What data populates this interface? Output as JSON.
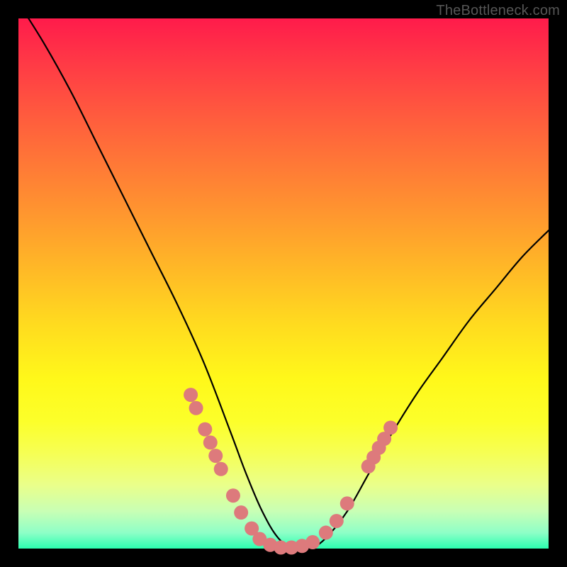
{
  "watermark": "TheBottleneck.com",
  "colors": {
    "frame_border": "#000000",
    "gradient_top": "#ff1b4b",
    "gradient_bottom": "#2bffb0",
    "curve": "#000000",
    "markers": "#dd7a7c"
  },
  "chart_data": {
    "type": "line",
    "title": "",
    "xlabel": "",
    "ylabel": "",
    "xlim": [
      0,
      100
    ],
    "ylim": [
      0,
      100
    ],
    "series": [
      {
        "name": "bottleneck-curve",
        "x": [
          0,
          5,
          10,
          15,
          20,
          25,
          30,
          35,
          40,
          43,
          46,
          49,
          52,
          55,
          58,
          62,
          66,
          70,
          75,
          80,
          85,
          90,
          95,
          100
        ],
        "values": [
          103,
          95,
          86,
          76,
          66,
          56,
          46,
          35,
          22,
          14,
          7,
          2,
          0,
          0,
          2,
          7,
          14,
          21,
          29,
          36,
          43,
          49,
          55,
          60
        ]
      }
    ],
    "markers": [
      {
        "x": 32.5,
        "y": 29.0
      },
      {
        "x": 33.5,
        "y": 26.5
      },
      {
        "x": 35.2,
        "y": 22.5
      },
      {
        "x": 36.2,
        "y": 20.0
      },
      {
        "x": 37.2,
        "y": 17.5
      },
      {
        "x": 38.2,
        "y": 15.0
      },
      {
        "x": 40.5,
        "y": 10.0
      },
      {
        "x": 42.0,
        "y": 6.8
      },
      {
        "x": 44.0,
        "y": 3.8
      },
      {
        "x": 45.5,
        "y": 1.8
      },
      {
        "x": 47.5,
        "y": 0.7
      },
      {
        "x": 49.5,
        "y": 0.2
      },
      {
        "x": 51.5,
        "y": 0.2
      },
      {
        "x": 53.5,
        "y": 0.5
      },
      {
        "x": 55.5,
        "y": 1.2
      },
      {
        "x": 58.0,
        "y": 3.0
      },
      {
        "x": 60.0,
        "y": 5.2
      },
      {
        "x": 62.0,
        "y": 8.5
      },
      {
        "x": 66.0,
        "y": 15.5
      },
      {
        "x": 67.0,
        "y": 17.2
      },
      {
        "x": 68.0,
        "y": 19.0
      },
      {
        "x": 69.0,
        "y": 20.7
      },
      {
        "x": 70.2,
        "y": 22.8
      }
    ]
  }
}
